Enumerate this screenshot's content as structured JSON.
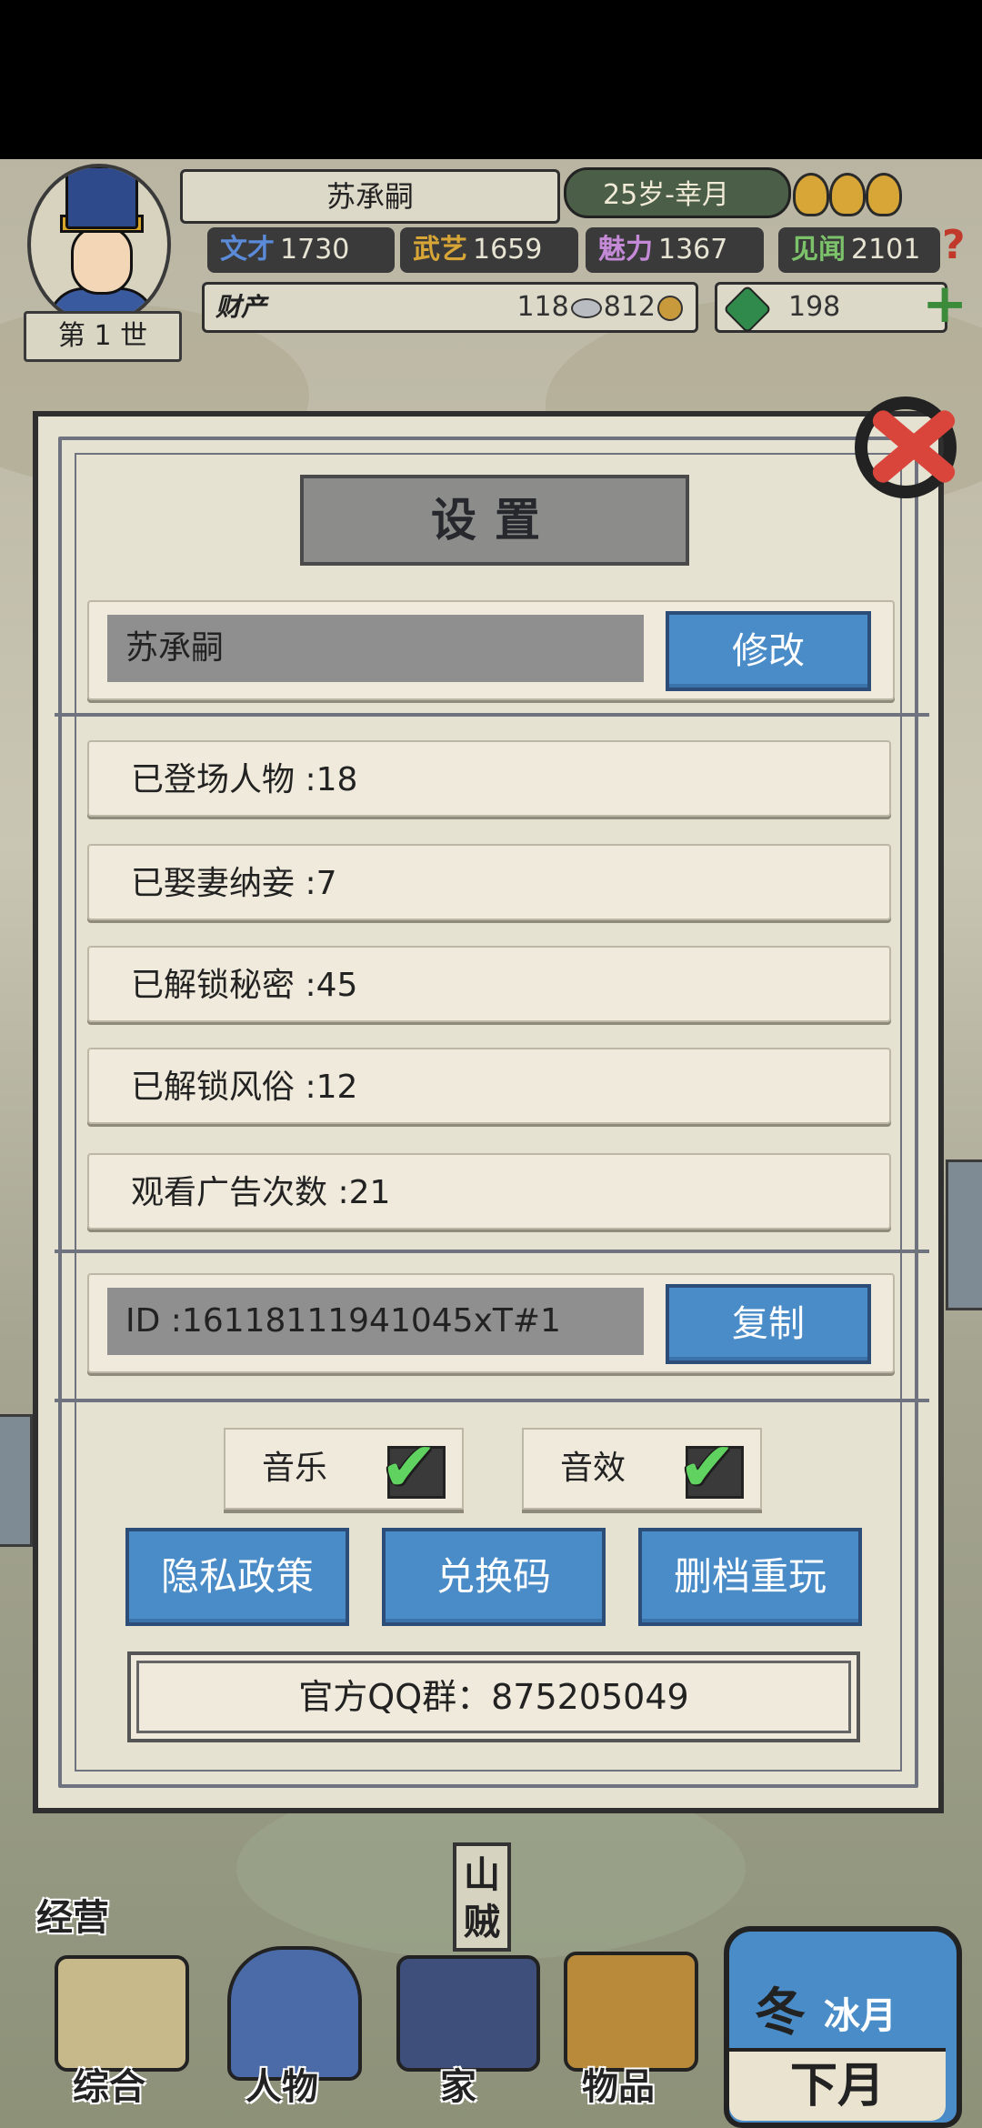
{
  "header": {
    "generation": "第 1 世",
    "name": "苏承嗣",
    "age_month": "25岁-幸月",
    "stats": [
      {
        "label": "文才",
        "value": "1730"
      },
      {
        "label": "武艺",
        "value": "1659"
      },
      {
        "label": "魅力",
        "value": "1367"
      },
      {
        "label": "见闻",
        "value": "2101"
      }
    ],
    "wealth_label": "财产",
    "silver": "118",
    "copper": "812",
    "jade": "198"
  },
  "dialog": {
    "title": "设置",
    "name_value": "苏承嗣",
    "modify_label": "修改",
    "stats": [
      "已登场人物 :18",
      "已娶妻纳妾 :7",
      "已解锁秘密 :45",
      "已解锁风俗 :12",
      "观看广告次数 :21"
    ],
    "id_value": "ID :16118111941045xT#1",
    "copy_label": "复制",
    "music_label": "音乐",
    "sfx_label": "音效",
    "music_on": true,
    "sfx_on": true,
    "privacy_label": "隐私政策",
    "redeem_label": "兑换码",
    "reset_label": "删档重玩",
    "qq_group": "官方QQ群：875205049"
  },
  "map": {
    "shan_label": "山贼"
  },
  "nav": {
    "manage": "经营",
    "general": "综合",
    "people": "人物",
    "home": "家",
    "items": "物品",
    "season": "冬",
    "month": "冰月",
    "next_month": "下月"
  },
  "colors": {
    "accent_blue": "#4a8cc8",
    "close_red": "#d9443b",
    "check_green": "#5fd25f"
  }
}
